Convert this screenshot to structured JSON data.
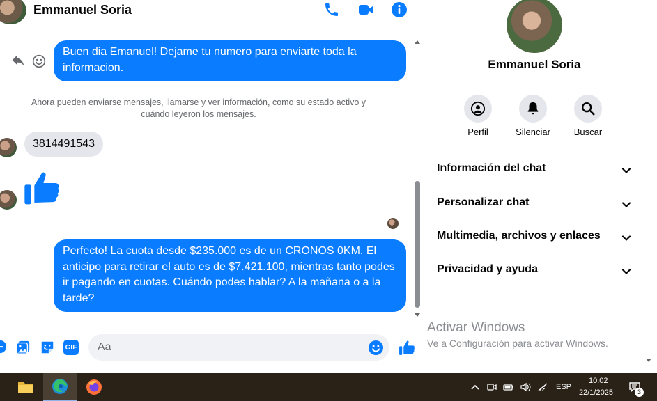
{
  "header": {
    "contact_name": "Emmanuel Soria",
    "icons": [
      "phone-icon",
      "video-camera-icon",
      "info-icon"
    ]
  },
  "messages": {
    "outgoing_1": "Buen dia Emanuel! Dejame tu numero para enviarte toda la informacion.",
    "system_notice": "Ahora pueden enviarse mensajes, llamarse y ver información, como su estado activo y cuándo leyeron los mensajes.",
    "incoming_1": "3814491543",
    "incoming_2_icon": "thumbs-up-icon",
    "outgoing_2": "Perfecto! La cuota desde $235.000 es de un CRONOS 0KM. El anticipo para retirar el auto es de $7.421.100, mientras tanto podes ir pagando en cuotas. Cuándo podes hablar? A la mañana o a la tarde?"
  },
  "composer": {
    "placeholder": "Aa",
    "gif_label": "GIF"
  },
  "info_panel": {
    "name": "Emmanuel Soria",
    "actions": [
      {
        "label": "Perfil",
        "icon": "profile-icon"
      },
      {
        "label": "Silenciar",
        "icon": "bell-icon"
      },
      {
        "label": "Buscar",
        "icon": "search-icon"
      }
    ],
    "sections": [
      {
        "label": "Información del chat"
      },
      {
        "label": "Personalizar chat"
      },
      {
        "label": "Multimedia, archivos y enlaces"
      },
      {
        "label": "Privacidad y ayuda"
      }
    ]
  },
  "watermark": {
    "title": "Activar Windows",
    "subtitle": "Ve a Configuración para activar Windows."
  },
  "taskbar": {
    "language": "ESP",
    "time": "10:02",
    "date": "22/1/2025",
    "notification_count": "3"
  },
  "colors": {
    "accent": "#0a7cff",
    "bubble_incoming": "#e4e6eb",
    "taskbar": "#2a2117"
  }
}
